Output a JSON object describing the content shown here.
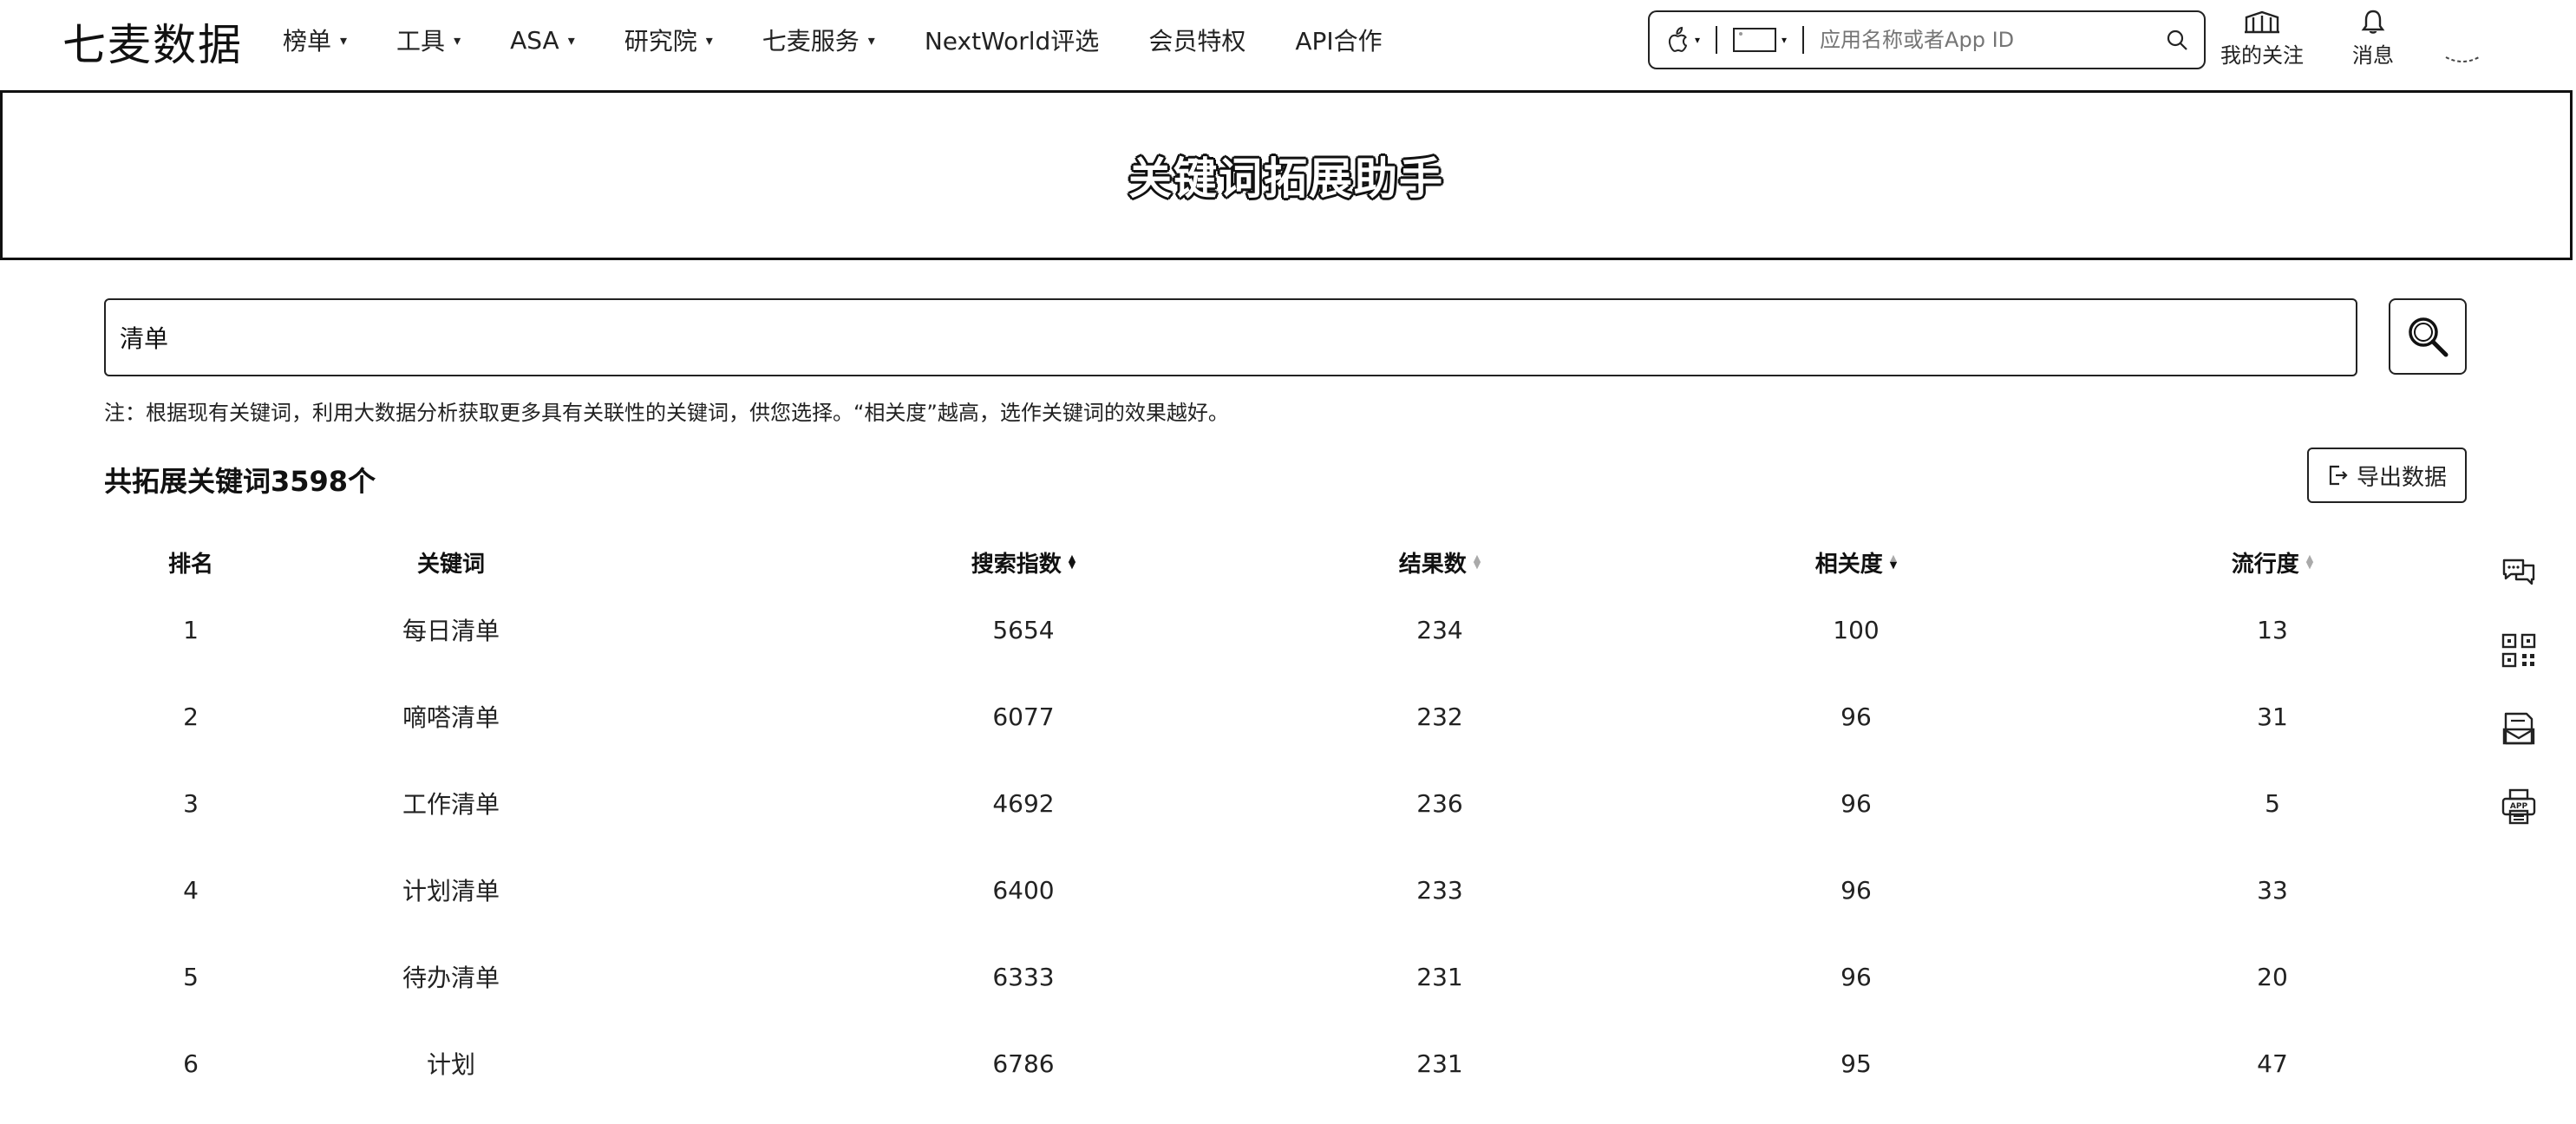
{
  "nav": {
    "logo": "七麦数据",
    "menu": [
      {
        "label": "榜单",
        "has_dropdown": true
      },
      {
        "label": "工具",
        "has_dropdown": true
      },
      {
        "label": "ASA",
        "has_dropdown": true
      },
      {
        "label": "研究院",
        "has_dropdown": true
      },
      {
        "label": "七麦服务",
        "has_dropdown": true
      },
      {
        "label": "NextWorld评选",
        "has_dropdown": false
      },
      {
        "label": "会员特权",
        "has_dropdown": false
      },
      {
        "label": "API合作",
        "has_dropdown": false
      }
    ],
    "search": {
      "placeholder": "应用名称或者App ID",
      "platform_icon": "apple-icon",
      "device_icon": "tablet-icon"
    },
    "follow_label": "我的关注",
    "messages_label": "消息"
  },
  "banner": {
    "title": "关键词拓展助手"
  },
  "keyword_search": {
    "value": "清单"
  },
  "note": "注：根据现有关键词，利用大数据分析获取更多具有关联性的关键词，供您选择。“相关度”越高，选作关键词的效果越好。",
  "summary": "共拓展关键词3598个",
  "export_label": "导出数据",
  "table": {
    "headers": [
      "排名",
      "关键词",
      "搜索指数",
      "结果数",
      "相关度",
      "流行度"
    ],
    "rows": [
      [
        "1",
        "每日清单",
        "5654",
        "234",
        "100",
        "13"
      ],
      [
        "2",
        "嘀嗒清单",
        "6077",
        "232",
        "96",
        "31"
      ],
      [
        "3",
        "工作清单",
        "4692",
        "236",
        "96",
        "5"
      ],
      [
        "4",
        "计划清单",
        "6400",
        "233",
        "96",
        "33"
      ],
      [
        "5",
        "待办清单",
        "6333",
        "231",
        "96",
        "20"
      ],
      [
        "6",
        "计划",
        "6786",
        "231",
        "95",
        "47"
      ]
    ]
  },
  "side_tools": [
    "chat-icon",
    "qr-code-icon",
    "mail-icon",
    "app-print-icon"
  ]
}
